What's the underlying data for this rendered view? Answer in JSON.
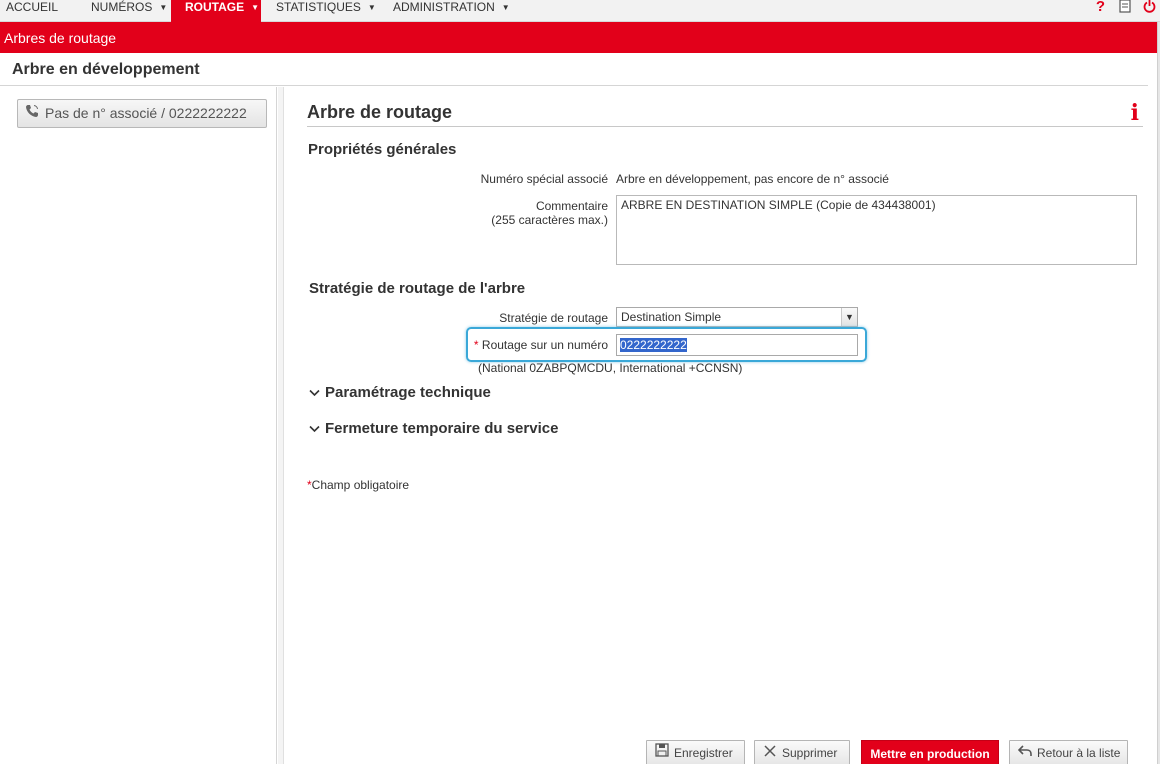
{
  "nav": {
    "items": [
      {
        "label": "ACCUEIL",
        "has_menu": false,
        "active": false
      },
      {
        "label": "NUMÉROS",
        "has_menu": true,
        "active": false
      },
      {
        "label": "ROUTAGE",
        "has_menu": true,
        "active": true
      },
      {
        "label": "STATISTIQUES",
        "has_menu": true,
        "active": false
      },
      {
        "label": "ADMINISTRATION",
        "has_menu": true,
        "active": false
      }
    ],
    "icons": [
      "help-icon",
      "document-icon",
      "power-icon"
    ]
  },
  "title_bar": {
    "label": "Arbres de routage"
  },
  "subheader": {
    "label": "Arbre en développement"
  },
  "sidebar": {
    "assoc_button_label": "Pas de n° associé / 0222222222",
    "assoc_icon": "phone-icon"
  },
  "main": {
    "title": "Arbre de routage",
    "info_icon_glyph": "i",
    "general": {
      "heading": "Propriétés générales",
      "special_number_label": "Numéro spécial associé",
      "special_number_value": "Arbre en développement, pas encore de n° associé",
      "comment_label": "Commentaire",
      "comment_hint": "(255 caractères max.)",
      "comment_value": "ARBRE EN DESTINATION SIMPLE (Copie de 434438001)"
    },
    "strategy": {
      "heading": "Stratégie de routage de l'arbre",
      "strategy_label": "Stratégie de routage",
      "strategy_value": "Destination Simple",
      "number_required_mark": "*",
      "number_label": "Routage sur un numéro",
      "number_value": "0222222222",
      "number_hint": "(National 0ZABPQMCDU, International +CCNSN)"
    },
    "technical_heading": "Paramétrage technique",
    "closure_heading": "Fermeture temporaire du service",
    "mandatory_mark": "*",
    "mandatory_note": "Champ obligatoire"
  },
  "actions": {
    "save": "Enregistrer",
    "delete": "Supprimer",
    "production": "Mettre en production",
    "back": "Retour à la liste"
  },
  "colors": {
    "brand_red": "#e2001a",
    "focus_blue": "#3aa8d8",
    "selection_blue": "#3366cc"
  }
}
